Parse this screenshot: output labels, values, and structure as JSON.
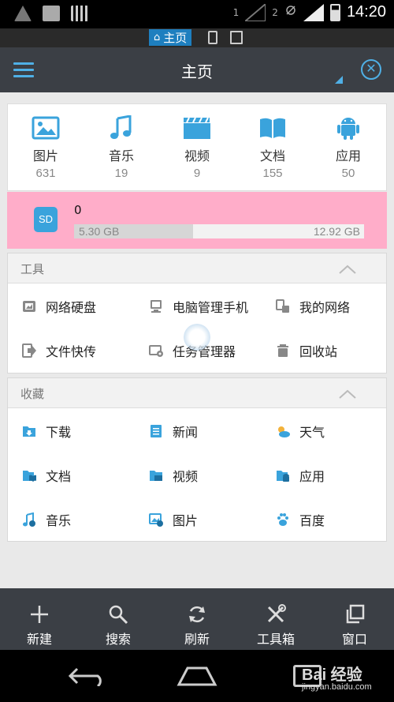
{
  "status_bar": {
    "sim1": "1",
    "sim2": "2",
    "time": "14:20"
  },
  "sub_bar": {
    "home_tab_label": "主页",
    "icons": [
      "phone-icon",
      "multi-device-icon"
    ]
  },
  "app_bar": {
    "title": "主页",
    "menu_icon": "hamburger-icon",
    "close_icon": "close-circle-icon",
    "accent": "#4fb0e6"
  },
  "categories": [
    {
      "label": "图片",
      "count": "631",
      "icon": "image-icon"
    },
    {
      "label": "音乐",
      "count": "19",
      "icon": "music-icon"
    },
    {
      "label": "视频",
      "count": "9",
      "icon": "video-icon"
    },
    {
      "label": "文档",
      "count": "155",
      "icon": "book-icon"
    },
    {
      "label": "应用",
      "count": "50",
      "icon": "android-icon"
    }
  ],
  "storage": {
    "icon_label": "SD",
    "name": "0",
    "used": "5.30 GB",
    "total": "12.92 GB",
    "used_fraction": 0.41,
    "color": "#ffadc9"
  },
  "tools": {
    "title": "工具",
    "items": [
      {
        "label": "网络硬盘",
        "icon": "cloud-drive-icon"
      },
      {
        "label": "电脑管理手机",
        "icon": "pc-manage-icon"
      },
      {
        "label": "我的网络",
        "icon": "my-network-icon"
      },
      {
        "label": "文件快传",
        "icon": "file-transfer-icon"
      },
      {
        "label": "任务管理器",
        "icon": "task-manager-icon"
      },
      {
        "label": "回收站",
        "icon": "trash-icon"
      }
    ]
  },
  "favorites": {
    "title": "收藏",
    "items": [
      {
        "label": "下载",
        "icon": "download-folder-icon"
      },
      {
        "label": "新闻",
        "icon": "news-icon"
      },
      {
        "label": "天气",
        "icon": "weather-icon"
      },
      {
        "label": "文档",
        "icon": "documents-icon"
      },
      {
        "label": "视频",
        "icon": "video-folder-icon"
      },
      {
        "label": "应用",
        "icon": "apps-icon"
      },
      {
        "label": "音乐",
        "icon": "music-folder-icon"
      },
      {
        "label": "图片",
        "icon": "pictures-icon"
      },
      {
        "label": "百度",
        "icon": "baidu-icon"
      }
    ]
  },
  "toolbar": {
    "items": [
      {
        "label": "新建",
        "icon": "plus-icon"
      },
      {
        "label": "搜索",
        "icon": "search-icon"
      },
      {
        "label": "刷新",
        "icon": "refresh-icon"
      },
      {
        "label": "工具箱",
        "icon": "tools-icon"
      },
      {
        "label": "窗口",
        "icon": "windows-icon"
      }
    ]
  },
  "watermark": {
    "brand": "Bai 经验",
    "url": "jingyan.baidu.com"
  }
}
